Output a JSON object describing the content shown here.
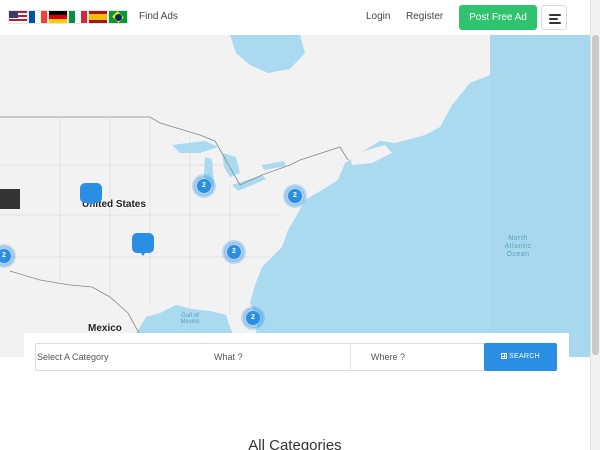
{
  "header": {
    "languages": [
      "English (US)",
      "French",
      "German",
      "Italian",
      "Spanish",
      "Portuguese (Brazil)"
    ],
    "find_ads": "Find Ads",
    "login": "Login",
    "register": "Register",
    "post_free_ad": "Post Free Ad",
    "menu_icon": "hamburger-menu-icon"
  },
  "map": {
    "labels": {
      "united_states": "United States",
      "mexico": "Mexico",
      "gulf": "Gulf of Mexico",
      "ocean": "North Atlantic Ocean"
    },
    "clusters": [
      "2",
      "2",
      "2",
      "2",
      "2"
    ],
    "colors": {
      "water": "#aadaef",
      "land": "#f2f2f2",
      "marker": "#2a8ee3"
    }
  },
  "search": {
    "category_placeholder": "Select A Category",
    "what_placeholder": "What ?",
    "where_placeholder": "Where ?",
    "button_label": "SEARCH",
    "button_icon": "grid-icon"
  },
  "categories": {
    "title": "All Categories"
  },
  "colors": {
    "accent": "#2a8ee3",
    "post_button": "#2fc36e"
  }
}
